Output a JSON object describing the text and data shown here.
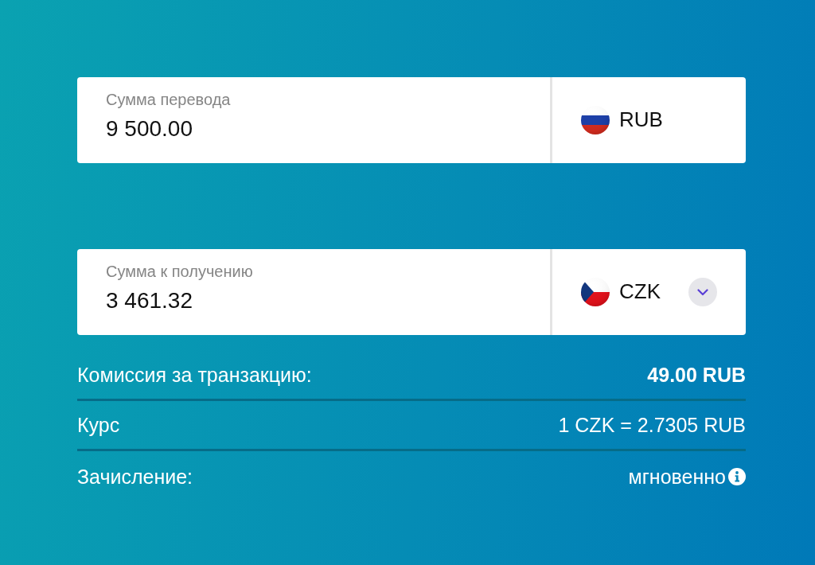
{
  "amounts": [
    {
      "label": "Сумма перевода",
      "value": "9 500.00",
      "currency": "RUB",
      "kind": "russia",
      "dropdown": false
    },
    {
      "label": "Сумма к получению",
      "value": "3 461.32",
      "currency": "CZK",
      "kind": "czechia",
      "dropdown": true
    }
  ],
  "details": [
    {
      "label": "Комиссия за транзакцию:",
      "value": "49.00 RUB",
      "bold": true,
      "info": false
    },
    {
      "label": "Курс",
      "value": "1 CZK = 2.7305 RUB",
      "bold": false,
      "info": false
    },
    {
      "label": "Зачисление:",
      "value": "мгновенно",
      "bold": false,
      "info": true
    }
  ]
}
